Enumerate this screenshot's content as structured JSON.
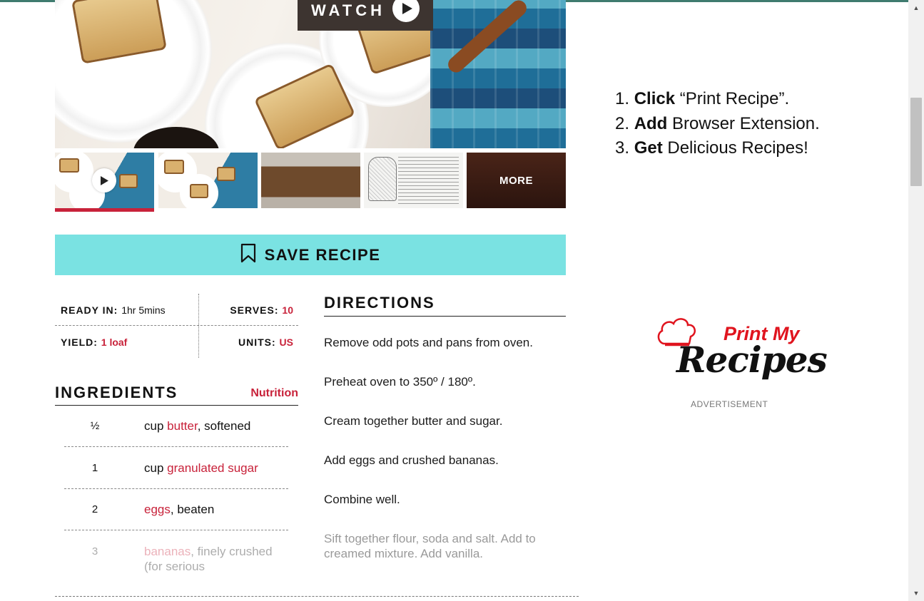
{
  "hero": {
    "watch_label": "WATCH"
  },
  "thumbnails": {
    "more_label": "MORE"
  },
  "save": {
    "label": "SAVE RECIPE"
  },
  "meta": {
    "ready_in_label": "READY IN:",
    "ready_in_value": "1hr 5mins",
    "serves_label": "SERVES:",
    "serves_value": "10",
    "yield_label": "YIELD:",
    "yield_value": "1 loaf",
    "units_label": "UNITS:",
    "units_value": "US"
  },
  "ingredients": {
    "title": "INGREDIENTS",
    "nutrition_link": "Nutrition",
    "items": [
      {
        "qty": "½",
        "unit": "cup",
        "name": "butter",
        "note": ", softened"
      },
      {
        "qty": "1",
        "unit": "cup",
        "name": "granulated sugar",
        "note": ""
      },
      {
        "qty": "2",
        "unit": "",
        "name": "eggs",
        "note": ", beaten"
      },
      {
        "qty": "3",
        "unit": "",
        "name": "bananas",
        "note": ", finely crushed (for serious"
      }
    ]
  },
  "directions": {
    "title": "DIRECTIONS",
    "steps": [
      "Remove odd pots and pans from oven.",
      "Preheat oven to 350º / 180º.",
      "Cream together butter and sugar.",
      "Add eggs and crushed bananas.",
      "Combine well.",
      "Sift together flour, soda and salt. Add to creamed mixture. Add vanilla."
    ]
  },
  "ad": {
    "steps": [
      {
        "num": "1.",
        "bold": "Click",
        "rest": " “Print Recipe”."
      },
      {
        "num": "2.",
        "bold": "Add",
        "rest": " Browser Extension."
      },
      {
        "num": "3.",
        "bold": "Get",
        "rest": " Delicious Recipes!"
      }
    ],
    "logo_line1": "Print My",
    "logo_line2": "Recipes",
    "label": "ADVERTISEMENT"
  },
  "colors": {
    "accent_red": "#c8223a",
    "save_bg": "#7ae2e2",
    "top_strip": "#3f7b6f"
  }
}
